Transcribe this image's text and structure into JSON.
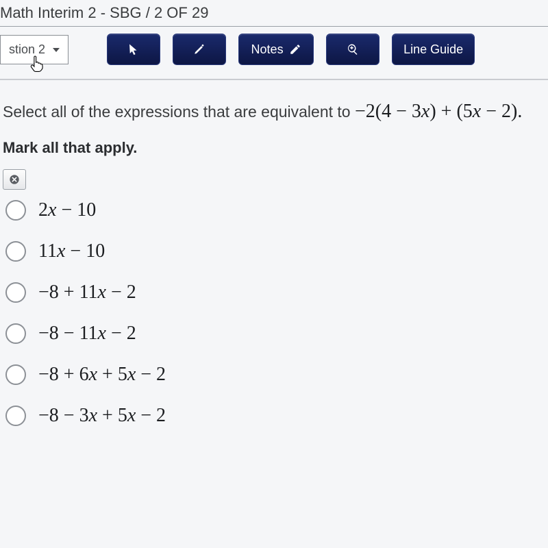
{
  "header": {
    "title": "Math Interim 2 - SBG / 2 OF 29"
  },
  "toolbar": {
    "question_label": "stion 2",
    "notes_label": "Notes",
    "line_guide_label": "Line Guide"
  },
  "question": {
    "prompt_prefix": "Select all of the expressions that are equivalent to ",
    "expression": "−2(4 − 3x) + (5x − 2).",
    "instruction": "Mark all that apply."
  },
  "options": [
    "2x − 10",
    "11x − 10",
    "−8 + 11x − 2",
    "−8 − 11x − 2",
    "−8 + 6x + 5x − 2",
    "−8 − 3x + 5x − 2"
  ]
}
